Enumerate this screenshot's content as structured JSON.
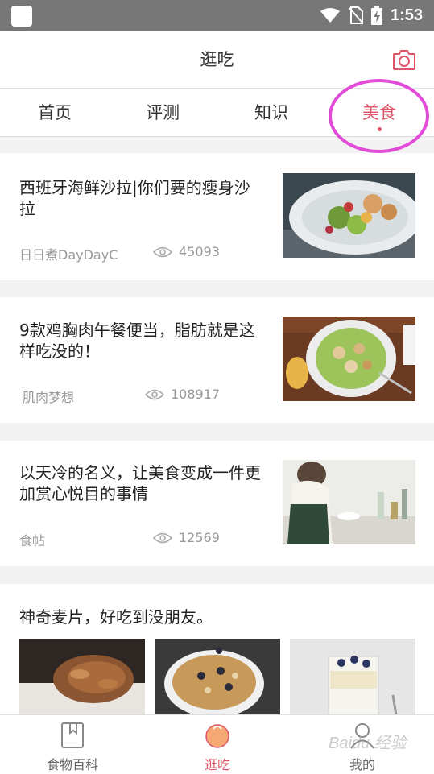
{
  "status_bar": {
    "time": "1:53"
  },
  "header": {
    "title": "逛吃"
  },
  "tabs": [
    {
      "label": "首页"
    },
    {
      "label": "评测"
    },
    {
      "label": "知识"
    },
    {
      "label": "美食"
    }
  ],
  "articles": [
    {
      "title": "西班牙海鲜沙拉|你们要的瘦身沙拉",
      "source": "日日煮DayDayC",
      "views": "45093"
    },
    {
      "title": "9款鸡胸肉午餐便当，脂肪就是这样吃没的！",
      "source": "肌肉梦想",
      "views": "108917"
    },
    {
      "title": "以天冷的名义，让美食变成一件更加赏心悦目的事情",
      "source": "食帖",
      "views": "12569"
    },
    {
      "title": "神奇麦片，好吃到没朋友。"
    }
  ],
  "bottom_nav": [
    {
      "label": "食物百科"
    },
    {
      "label": "逛吃"
    },
    {
      "label": "我的"
    }
  ],
  "watermark": "Baidu 经验",
  "colors": {
    "accent": "#e0546a",
    "status_bar": "#777777",
    "annotation_ring": "#e24bd8"
  }
}
